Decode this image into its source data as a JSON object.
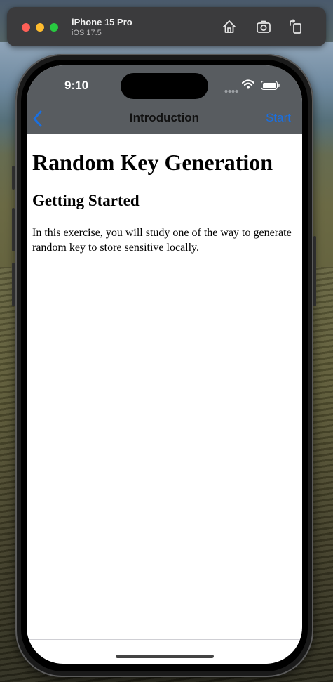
{
  "simulator": {
    "device_name": "iPhone 15 Pro",
    "os_version": "iOS 17.5",
    "icons": [
      "home-icon",
      "screenshot-icon",
      "rotate-icon"
    ]
  },
  "status_bar": {
    "time": "9:10"
  },
  "nav_bar": {
    "title": "Introduction",
    "back_icon": "chevron-left-icon",
    "right_button": "Start",
    "accent_color": "#1a6fe0"
  },
  "content": {
    "heading": "Random Key Generation",
    "subheading": "Getting Started",
    "paragraph": "In this exercise, you will study one of the way to generate random key to store sensitive locally."
  }
}
